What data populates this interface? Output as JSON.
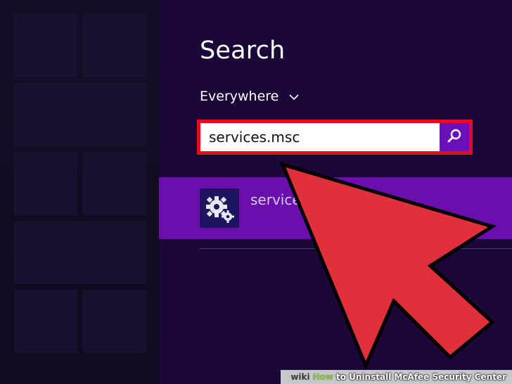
{
  "search_pane": {
    "title": "Search",
    "scope": {
      "label": "Everywhere",
      "icon": "chevron-down-icon"
    },
    "search": {
      "value": "services.msc",
      "button_icon": "search-icon",
      "highlight_color": "#e0101a"
    },
    "results": [
      {
        "label": "services",
        "icon": "gears-icon"
      }
    ]
  },
  "overlay": {
    "arrow_color": "#e0303b"
  },
  "watermark": {
    "wiki": "wiki",
    "how": "How",
    "rest": "to Uninstall McAfee Security Center"
  },
  "colors": {
    "charm_bg": "#1b0738",
    "accent": "#6a10b8",
    "result_highlight": "#6a0fae"
  }
}
